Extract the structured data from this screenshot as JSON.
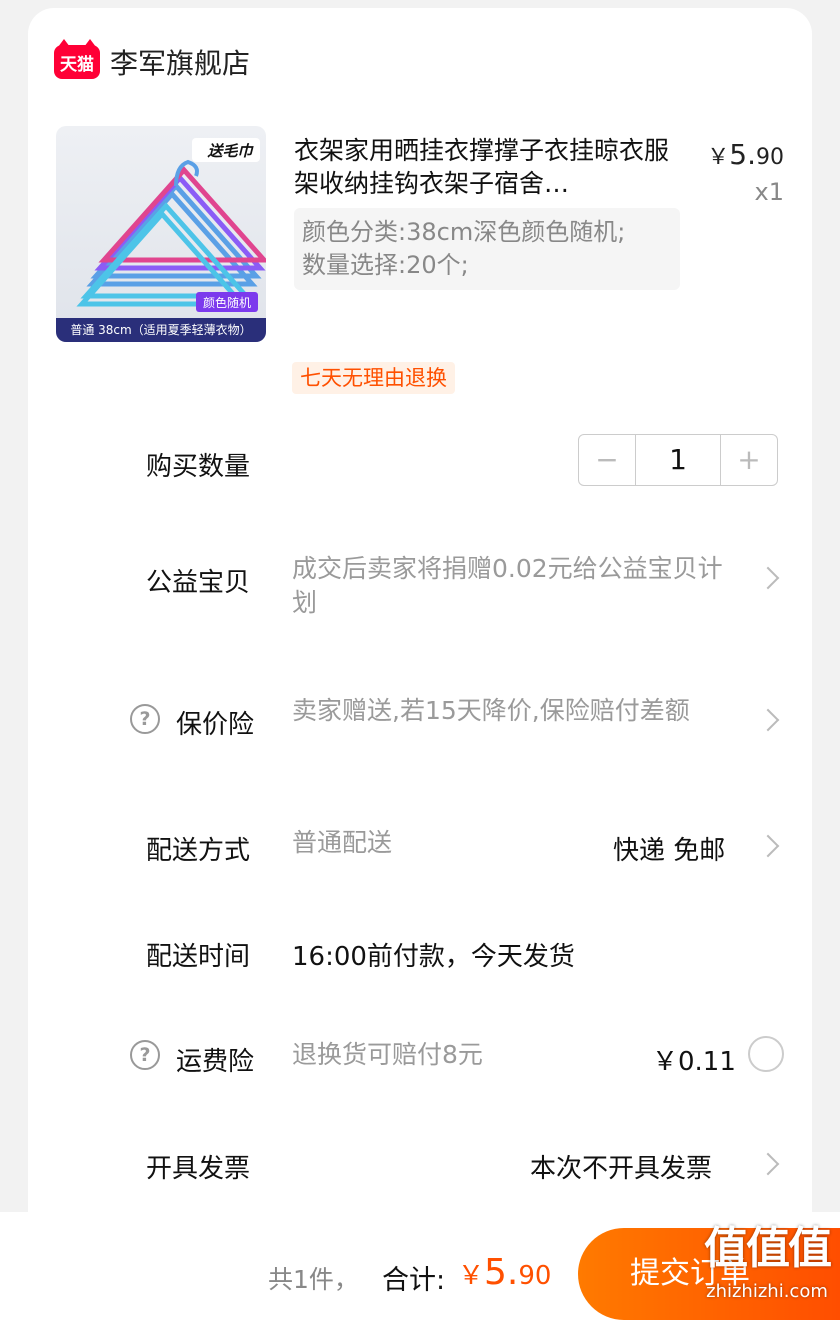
{
  "shop": {
    "logo_text": "天猫",
    "name": "李军旗舰店"
  },
  "item": {
    "image_badge": "送毛巾",
    "image_color_tag": "颜色随机",
    "image_caption": "普通 38cm（适用夏季轻薄衣物）",
    "title": "衣架家用晒挂衣撑撑子衣挂晾衣服架收纳挂钩衣架子宿舍…",
    "price_currency": "￥",
    "price_int": "5.",
    "price_dec": "90",
    "quantity_label": "x1",
    "spec_line1": "颜色分类:38cm深色颜色随机;",
    "spec_line2": "数量选择:20个;",
    "return_tag": "七天无理由退换"
  },
  "rows": {
    "quantity": {
      "label": "购买数量",
      "minus": "−",
      "value": "1",
      "plus": "+"
    },
    "charity": {
      "label": "公益宝贝",
      "desc": "成交后卖家将捐赠0.02元给公益宝贝计划"
    },
    "price_protect": {
      "label": "保价险",
      "desc": "卖家赠送,若15天降价,保险赔付差额"
    },
    "delivery": {
      "label": "配送方式",
      "desc": "普通配送",
      "right": "快递 免邮"
    },
    "delivery_time": {
      "label": "配送时间",
      "value": "16:00前付款，今天发货"
    },
    "shipping_insurance": {
      "label": "运费险",
      "desc": "退换货可赔付8元",
      "price": "￥0.11"
    },
    "invoice": {
      "label": "开具发票",
      "right": "本次不开具发票"
    }
  },
  "bottom": {
    "count": "共1件，",
    "total_label": "合计:",
    "total_currency": "￥",
    "total_int": "5.",
    "total_dec": "90",
    "submit_label": "提交订单"
  },
  "watermark": {
    "logo": "值值值",
    "url": "zhizhizhi.com"
  },
  "colors": {
    "accent": "#ff5000",
    "tmall_red": "#ff0036"
  },
  "icons": [
    "help-circle-icon",
    "chevron-right-icon",
    "radio-circle-icon"
  ]
}
